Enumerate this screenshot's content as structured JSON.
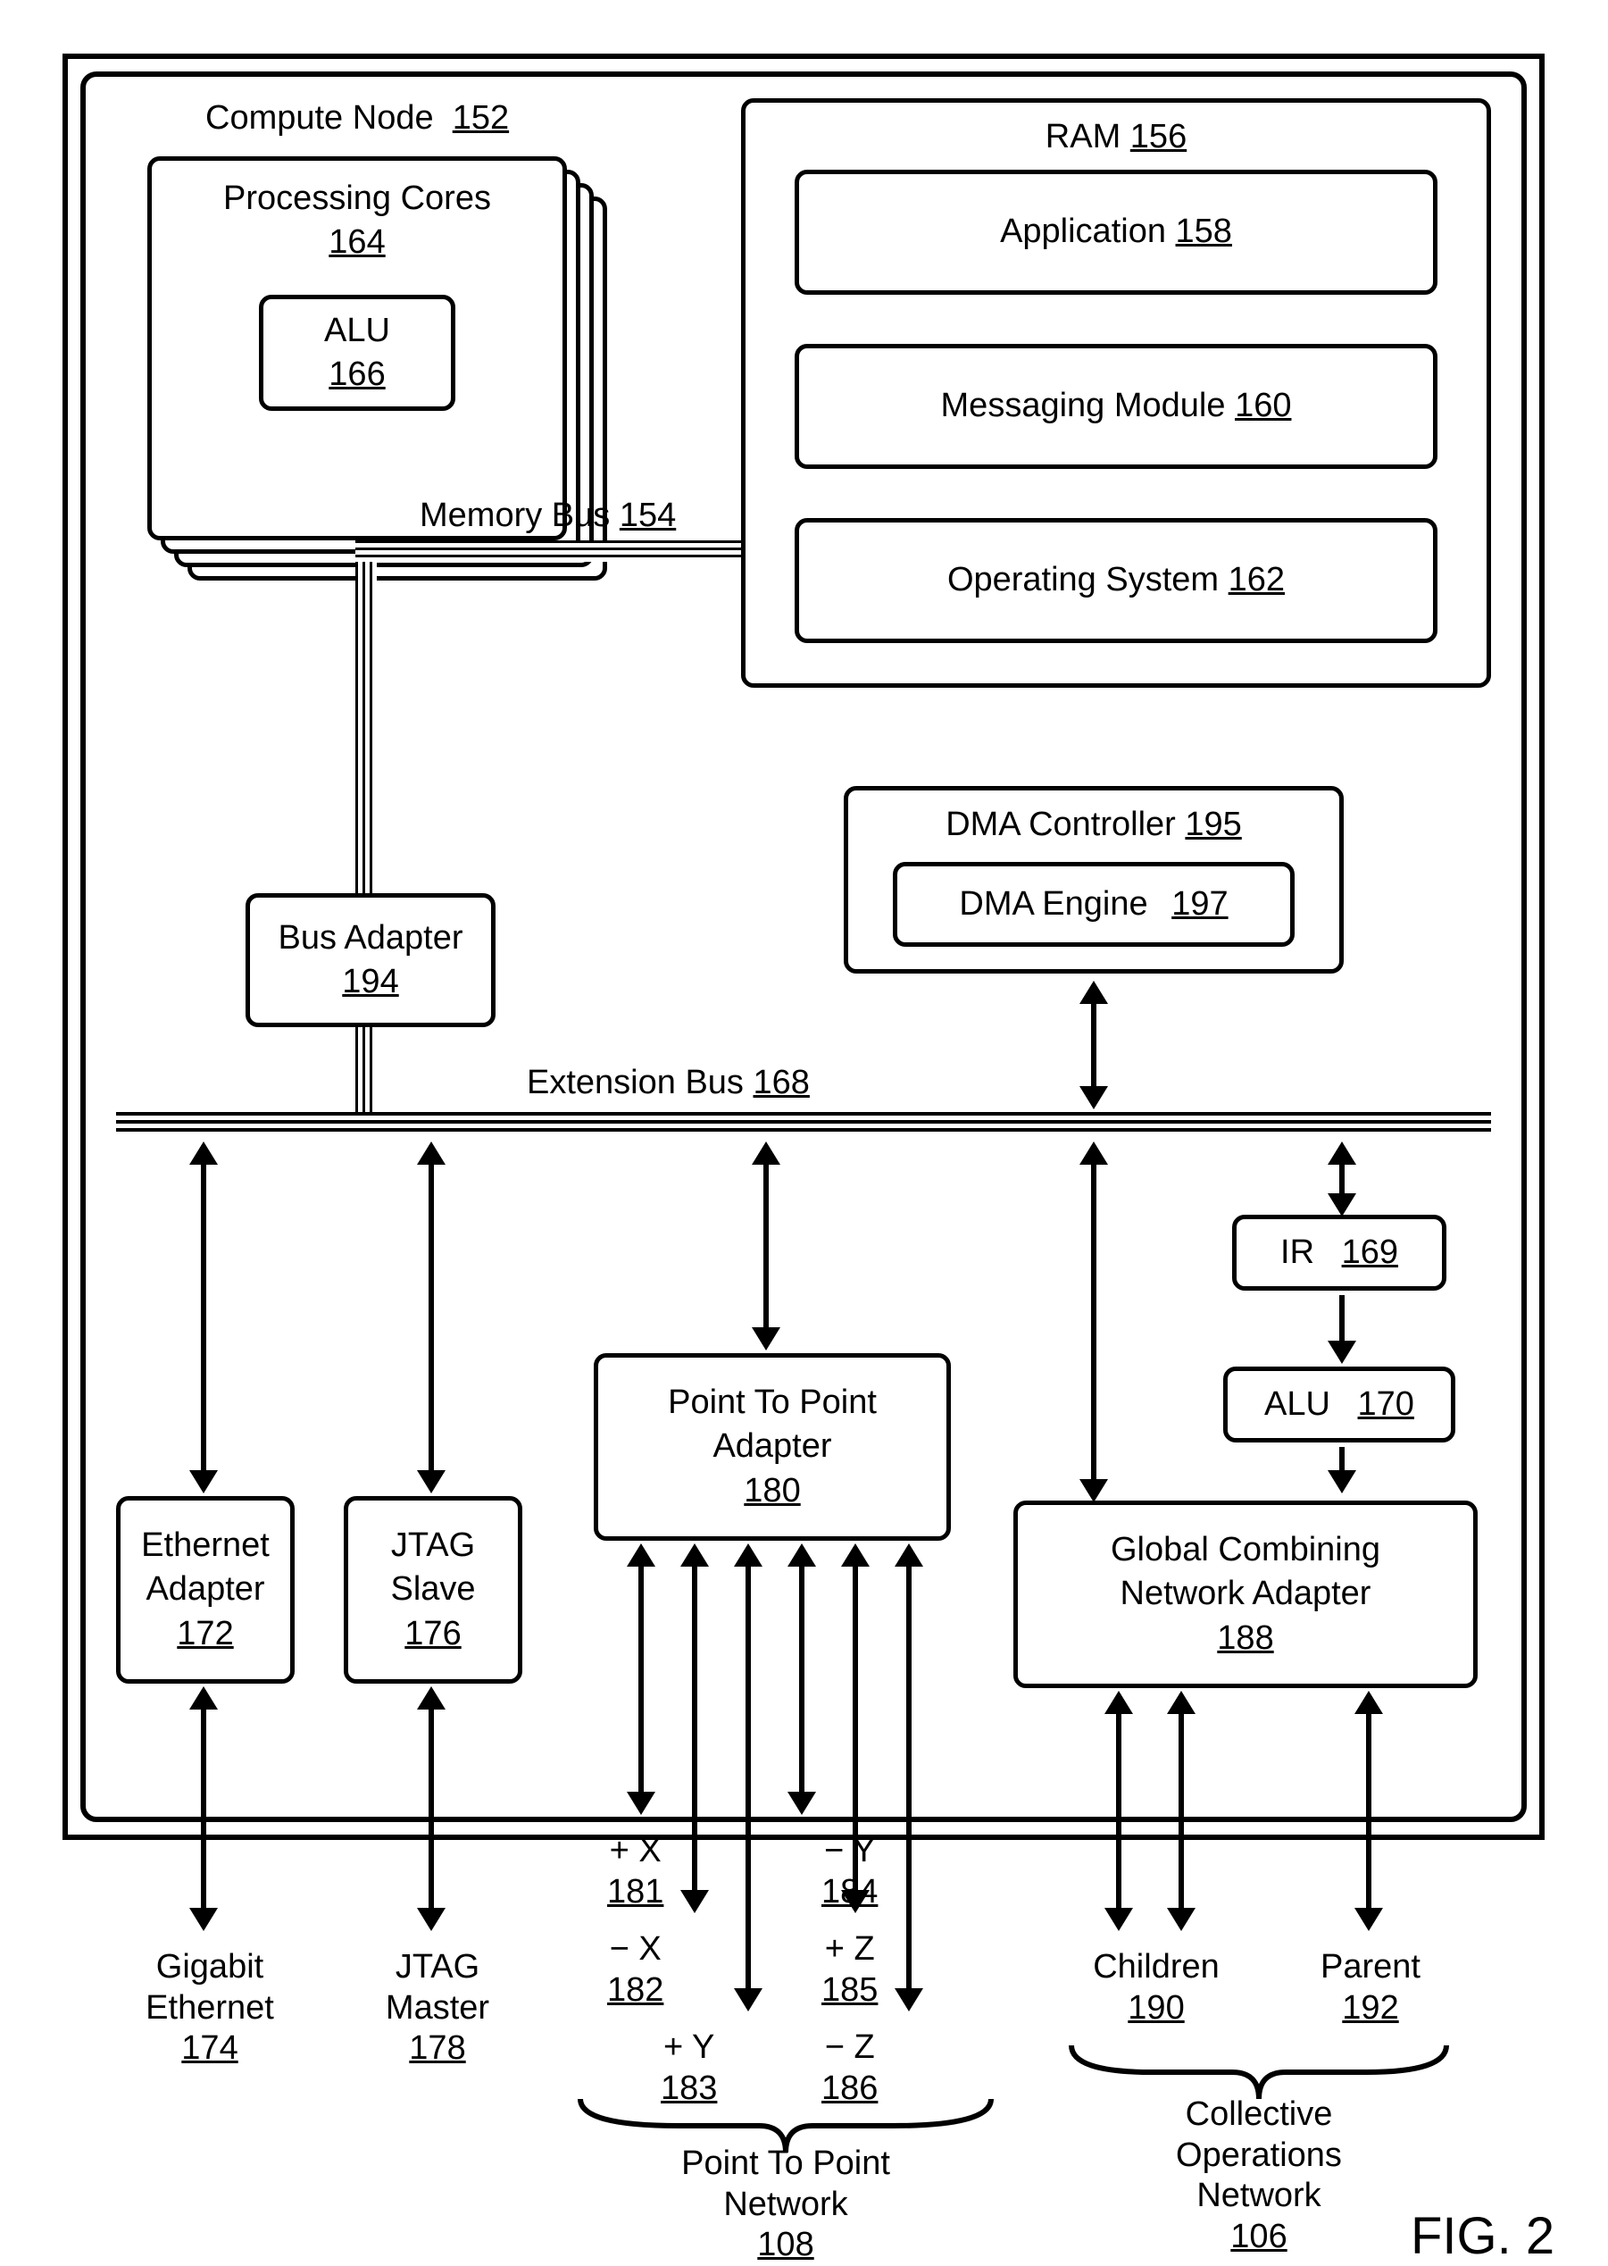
{
  "figure": "FIG. 2",
  "compute_node": {
    "label": "Compute Node",
    "ref": "152"
  },
  "processing_cores": {
    "label": "Processing Cores",
    "ref": "164"
  },
  "alu_core": {
    "label": "ALU",
    "ref": "166"
  },
  "ram": {
    "label": "RAM",
    "ref": "156"
  },
  "application": {
    "label": "Application",
    "ref": "158"
  },
  "messaging_module": {
    "label": "Messaging Module",
    "ref": "160"
  },
  "operating_system": {
    "label": "Operating System",
    "ref": "162"
  },
  "memory_bus": {
    "label": "Memory Bus",
    "ref": "154"
  },
  "bus_adapter": {
    "label": "Bus Adapter",
    "ref": "194"
  },
  "dma_controller": {
    "label": "DMA Controller",
    "ref": "195"
  },
  "dma_engine": {
    "label": "DMA Engine",
    "ref": "197"
  },
  "extension_bus": {
    "label": "Extension Bus",
    "ref": "168"
  },
  "ir": {
    "label": "IR",
    "ref": "169"
  },
  "alu2": {
    "label": "ALU",
    "ref": "170"
  },
  "ethernet_adapter": {
    "label": "Ethernet\nAdapter",
    "ref": "172"
  },
  "jtag_slave": {
    "label": "JTAG\nSlave",
    "ref": "176"
  },
  "p2p_adapter": {
    "label": "Point To Point\nAdapter",
    "ref": "180"
  },
  "gcn_adapter": {
    "label": "Global Combining\nNetwork Adapter",
    "ref": "188"
  },
  "gigabit": {
    "label": "Gigabit\nEthernet",
    "ref": "174"
  },
  "jtag_master": {
    "label": "JTAG\nMaster",
    "ref": "178"
  },
  "axes": {
    "px": {
      "label": "+ X",
      "ref": "181"
    },
    "mx": {
      "label": "− X",
      "ref": "182"
    },
    "py": {
      "label": "+ Y",
      "ref": "183"
    },
    "my": {
      "label": "− Y",
      "ref": "184"
    },
    "pz": {
      "label": "+ Z",
      "ref": "185"
    },
    "mz": {
      "label": "− Z",
      "ref": "186"
    }
  },
  "children": {
    "label": "Children",
    "ref": "190"
  },
  "parent": {
    "label": "Parent",
    "ref": "192"
  },
  "p2p_network": {
    "label": "Point To Point\nNetwork",
    "ref": "108"
  },
  "collective_network": {
    "label": "Collective\nOperations\nNetwork",
    "ref": "106"
  }
}
